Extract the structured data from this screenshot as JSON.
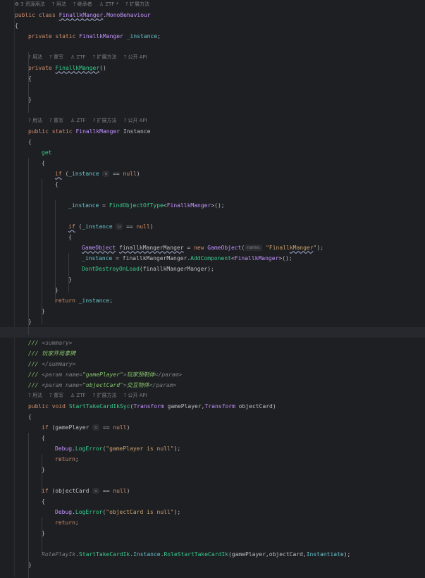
{
  "lines": [
    {
      "i": 1,
      "type": "hint",
      "items": [
        "✿ 3 资源用法",
        "? 用法",
        "? 继承者",
        "♙ ZTF *",
        "? 扩展方法"
      ]
    },
    {
      "i": 2,
      "code": [
        [
          "kw",
          "public "
        ],
        [
          "kw",
          "class "
        ],
        [
          "cls squig",
          "FinallkManger"
        ],
        [
          "",
          "."
        ],
        [
          "cls",
          "MonoBehaviour"
        ]
      ]
    },
    {
      "i": 3,
      "code": [
        [
          "",
          "{"
        ]
      ]
    },
    {
      "i": 4,
      "indent": 1,
      "code": [
        [
          "kw",
          "private "
        ],
        [
          "kw",
          "static "
        ],
        [
          "cls",
          "FinallkManger "
        ],
        [
          "fld",
          "_instance"
        ],
        [
          "",
          ";"
        ]
      ]
    },
    {
      "i": 5,
      "code": []
    },
    {
      "i": 6,
      "type": "hint",
      "indent": 1,
      "items": [
        "? 用法",
        "? 重写",
        "♙ ZTF",
        "? 扩展方法",
        "? 公开 API"
      ]
    },
    {
      "i": 7,
      "indent": 1,
      "code": [
        [
          "kw",
          "private "
        ],
        [
          "mth squig",
          "FinallkManger"
        ],
        [
          "",
          "()"
        ]
      ]
    },
    {
      "i": 8,
      "indent": 1,
      "code": [
        [
          "",
          "{"
        ]
      ]
    },
    {
      "i": 9,
      "code": []
    },
    {
      "i": 10,
      "indent": 1,
      "code": [
        [
          "",
          "}"
        ]
      ]
    },
    {
      "i": 11,
      "code": []
    },
    {
      "i": 12,
      "type": "hint",
      "indent": 1,
      "items": [
        "? 用法",
        "? 重写",
        "♙ ZTF",
        "? 扩展方法",
        "? 公开 API"
      ]
    },
    {
      "i": 13,
      "indent": 1,
      "code": [
        [
          "kw",
          "public "
        ],
        [
          "kw",
          "static "
        ],
        [
          "cls",
          "FinallkManger "
        ],
        [
          "",
          "Instance"
        ]
      ]
    },
    {
      "i": 14,
      "indent": 1,
      "code": [
        [
          "",
          "{"
        ]
      ]
    },
    {
      "i": 15,
      "indent": 2,
      "code": [
        [
          "mth",
          "get"
        ]
      ]
    },
    {
      "i": 16,
      "indent": 2,
      "code": [
        [
          "",
          "{"
        ]
      ]
    },
    {
      "i": 17,
      "indent": 3,
      "code": [
        [
          "kw squig",
          "if"
        ],
        [
          "",
          " ("
        ],
        [
          "fld",
          "_instance "
        ],
        [
          "inl",
          "u"
        ],
        [
          "",
          " == "
        ],
        [
          "kw",
          "null"
        ],
        [
          "",
          ")"
        ]
      ]
    },
    {
      "i": 18,
      "indent": 3,
      "code": [
        [
          "",
          "{"
        ]
      ]
    },
    {
      "i": 19,
      "code": []
    },
    {
      "i": 20,
      "indent": 4,
      "code": [
        [
          "fld",
          "_instance"
        ],
        [
          "",
          " = "
        ],
        [
          "mth",
          "FindObjectOfType"
        ],
        [
          "",
          "<"
        ],
        [
          "cls",
          "FinallkManger"
        ],
        [
          "",
          ">();"
        ]
      ]
    },
    {
      "i": 21,
      "code": []
    },
    {
      "i": 22,
      "indent": 4,
      "code": [
        [
          "kw squig",
          "if"
        ],
        [
          "",
          " ("
        ],
        [
          "fld",
          "_instance "
        ],
        [
          "inl",
          "u"
        ],
        [
          "",
          " == "
        ],
        [
          "kw",
          "null"
        ],
        [
          "",
          ")"
        ]
      ]
    },
    {
      "i": 23,
      "indent": 4,
      "code": [
        [
          "",
          "{"
        ]
      ]
    },
    {
      "i": 24,
      "indent": 5,
      "code": [
        [
          "cls squig",
          "GameObject"
        ],
        [
          "",
          " "
        ],
        [
          "squig",
          "finallkMangerManger"
        ],
        [
          "",
          " = "
        ],
        [
          "kw",
          "new "
        ],
        [
          "cls",
          "GameObject"
        ],
        [
          "",
          "("
        ],
        [
          "inl",
          "name:"
        ],
        [
          "",
          " "
        ],
        [
          "str",
          "\"Finall"
        ],
        [
          "str squig",
          "kManger"
        ],
        [
          "str",
          "\""
        ],
        [
          "",
          ");"
        ]
      ]
    },
    {
      "i": 25,
      "indent": 5,
      "code": [
        [
          "fld",
          "_instance"
        ],
        [
          "",
          " = finallkMangerManger."
        ],
        [
          "mth",
          "AddComponent"
        ],
        [
          "",
          "<"
        ],
        [
          "cls",
          "FinallkManger"
        ],
        [
          "",
          ">();"
        ]
      ]
    },
    {
      "i": 26,
      "indent": 5,
      "code": [
        [
          "mth",
          "DontDestroyOnLoad"
        ],
        [
          "",
          "(finallkMangerManger);"
        ]
      ]
    },
    {
      "i": 27,
      "indent": 4,
      "code": [
        [
          "",
          "}"
        ]
      ]
    },
    {
      "i": 28,
      "indent": 3,
      "code": [
        [
          "",
          "}"
        ]
      ]
    },
    {
      "i": 29,
      "indent": 3,
      "code": [
        [
          "kw",
          "return "
        ],
        [
          "fld",
          "_instance"
        ],
        [
          "",
          ";"
        ]
      ]
    },
    {
      "i": 30,
      "indent": 2,
      "code": [
        [
          "",
          "}"
        ]
      ]
    },
    {
      "i": 31,
      "indent": 1,
      "code": [
        [
          "",
          "}"
        ]
      ]
    },
    {
      "i": 32,
      "current": true,
      "code": []
    },
    {
      "i": 33,
      "indent": 1,
      "code": [
        [
          "cmt",
          "/// "
        ],
        [
          "tag",
          "<summary>"
        ]
      ]
    },
    {
      "i": 34,
      "indent": 1,
      "code": [
        [
          "cmt",
          "/// 玩家开局拿牌"
        ]
      ]
    },
    {
      "i": 35,
      "indent": 1,
      "code": [
        [
          "cmt",
          "/// "
        ],
        [
          "tag",
          "</summary>"
        ]
      ]
    },
    {
      "i": 36,
      "indent": 1,
      "code": [
        [
          "cmt",
          "/// "
        ],
        [
          "tag",
          "<param name="
        ],
        [
          "cmt",
          "\"gamePlayer\""
        ],
        [
          "tag",
          ">"
        ],
        [
          "cmt",
          "玩家预制体"
        ],
        [
          "tag",
          "</param>"
        ]
      ]
    },
    {
      "i": 37,
      "indent": 1,
      "code": [
        [
          "cmt",
          "/// "
        ],
        [
          "tag",
          "<param name="
        ],
        [
          "cmt",
          "\"objectCard\""
        ],
        [
          "tag",
          ">"
        ],
        [
          "cmt",
          "交互物体"
        ],
        [
          "tag",
          "</param>"
        ]
      ]
    },
    {
      "i": 38,
      "type": "hint",
      "indent": 1,
      "items": [
        "? 用法",
        "? 重写",
        "♙ ZTF",
        "? 扩展方法",
        "? 公开 API"
      ]
    },
    {
      "i": 39,
      "indent": 1,
      "code": [
        [
          "kw",
          "public "
        ],
        [
          "kw",
          "void "
        ],
        [
          "mth",
          "StartTakeCardIkSyc"
        ],
        [
          "",
          "("
        ],
        [
          "cls",
          "Transform "
        ],
        [
          "",
          "gamePlayer,"
        ],
        [
          "cls",
          "Transform "
        ],
        [
          "",
          "objectCard)"
        ]
      ]
    },
    {
      "i": 40,
      "indent": 1,
      "code": [
        [
          "",
          "{"
        ]
      ]
    },
    {
      "i": 41,
      "indent": 2,
      "code": [
        [
          "kw",
          "if"
        ],
        [
          "",
          " (gamePlayer "
        ],
        [
          "inl",
          "u"
        ],
        [
          "",
          " == "
        ],
        [
          "kw",
          "null"
        ],
        [
          "",
          ")"
        ]
      ]
    },
    {
      "i": 42,
      "indent": 2,
      "code": [
        [
          "",
          "{"
        ]
      ]
    },
    {
      "i": 43,
      "indent": 3,
      "code": [
        [
          "cls",
          "Debug"
        ],
        [
          "",
          "."
        ],
        [
          "mth",
          "LogError"
        ],
        [
          "",
          "("
        ],
        [
          "str",
          "\"gamePlayer is null\""
        ],
        [
          "",
          ");"
        ]
      ]
    },
    {
      "i": 44,
      "indent": 3,
      "code": [
        [
          "kw",
          "return"
        ],
        [
          "",
          ";"
        ]
      ]
    },
    {
      "i": 45,
      "indent": 2,
      "code": [
        [
          "",
          "}"
        ]
      ]
    },
    {
      "i": 46,
      "code": []
    },
    {
      "i": 47,
      "indent": 2,
      "code": [
        [
          "kw",
          "if"
        ],
        [
          "",
          " (objectCard "
        ],
        [
          "inl",
          "u"
        ],
        [
          "",
          " == "
        ],
        [
          "kw",
          "null"
        ],
        [
          "",
          ")"
        ]
      ]
    },
    {
      "i": 48,
      "indent": 2,
      "code": [
        [
          "",
          "{"
        ]
      ]
    },
    {
      "i": 49,
      "indent": 3,
      "code": [
        [
          "cls",
          "Debug"
        ],
        [
          "",
          "."
        ],
        [
          "mth",
          "LogError"
        ],
        [
          "",
          "("
        ],
        [
          "str",
          "\"objectCard is null\""
        ],
        [
          "",
          ");"
        ]
      ]
    },
    {
      "i": 50,
      "indent": 3,
      "code": [
        [
          "kw",
          "return"
        ],
        [
          "",
          ";"
        ]
      ]
    },
    {
      "i": 51,
      "indent": 2,
      "code": [
        [
          "",
          "}"
        ]
      ]
    },
    {
      "i": 52,
      "code": []
    },
    {
      "i": 53,
      "indent": 2,
      "code": [
        [
          "tag",
          "RolePlayIk"
        ],
        [
          "",
          "."
        ],
        [
          "mth",
          "StartTakeCardIk"
        ],
        [
          "",
          "."
        ],
        [
          "fld",
          "Instance"
        ],
        [
          "",
          "."
        ],
        [
          "mth",
          "RoleStartTakeCardIk"
        ],
        [
          "",
          "(gamePlayer,objectCard,"
        ],
        [
          "fld",
          "Instantiate"
        ],
        [
          "",
          ");"
        ]
      ]
    },
    {
      "i": 54,
      "indent": 1,
      "code": [
        [
          "",
          "}"
        ]
      ]
    }
  ]
}
